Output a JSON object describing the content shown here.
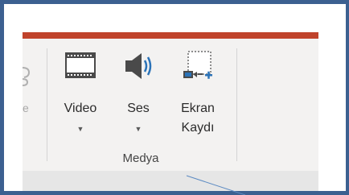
{
  "ribbon": {
    "partial_prev_label": "e",
    "group": {
      "label": "Medya",
      "commands": [
        {
          "id": "video",
          "label": "Video",
          "has_dropdown": true,
          "icon": "film-strip-icon"
        },
        {
          "id": "ses",
          "label": "Ses",
          "has_dropdown": true,
          "icon": "speaker-icon"
        },
        {
          "id": "ekran-kaydi",
          "label_line1": "Ekran",
          "label_line2": "Kaydı",
          "has_dropdown": false,
          "icon": "screen-recording-icon"
        }
      ]
    },
    "dropdown_glyph": "▼"
  },
  "colors": {
    "frame_border": "#3c6090",
    "ribbon_accent": "#c0432b",
    "ribbon_background": "#f3f2f1",
    "icon_blue": "#2b73b8",
    "icon_dark": "#4a4a4a"
  }
}
